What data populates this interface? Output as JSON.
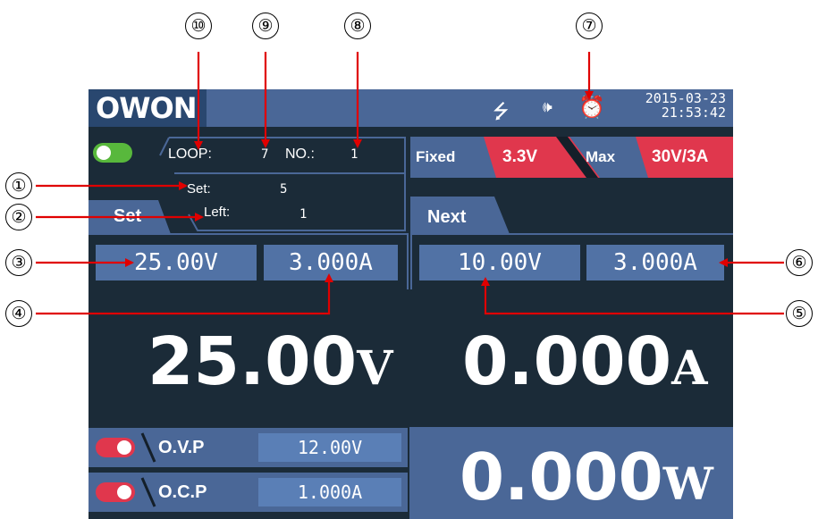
{
  "callouts": [
    "⑩",
    "⑨",
    "⑧",
    "⑦",
    "①",
    "②",
    "③",
    "④",
    "⑥",
    "⑤"
  ],
  "topbar": {
    "logo": "OWON",
    "date": "2015-03-23",
    "time": "21:53:42",
    "icons": [
      "usb-icon",
      "speaker-icon",
      "alarm-clock-icon"
    ]
  },
  "loop": {
    "loop_label": "LOOP:",
    "loop_value": "7",
    "no_label": "NO.:",
    "no_value": "1",
    "set_label": "Set:",
    "set_value": "5",
    "left_label": "Left:",
    "left_value": "1",
    "toggle_on": true
  },
  "banner": {
    "fixed_label": "Fixed",
    "fixed_value": "3.3V",
    "max_label": "Max",
    "max_value": "30V/3A"
  },
  "set": {
    "label": "Set",
    "voltage": "25.00V",
    "current": "3.000A"
  },
  "next": {
    "label": "Next",
    "voltage": "10.00V",
    "current": "3.000A"
  },
  "readout": {
    "voltage_value": "25.00",
    "voltage_unit": "V",
    "current_value": "0.000",
    "current_unit": "A",
    "power_value": "0.000",
    "power_unit": "W"
  },
  "protection": {
    "ovp_label": "O.V.P",
    "ovp_value": "12.00V",
    "ocp_label": "O.C.P",
    "ocp_value": "1.000A"
  },
  "colors": {
    "screen_bg": "#1b2b38",
    "panel_blue": "#4a6797",
    "value_blue": "#5172a5",
    "accent_red": "#e0374d",
    "toggle_green": "#58b83c",
    "callout_arrow": "#e00000"
  }
}
